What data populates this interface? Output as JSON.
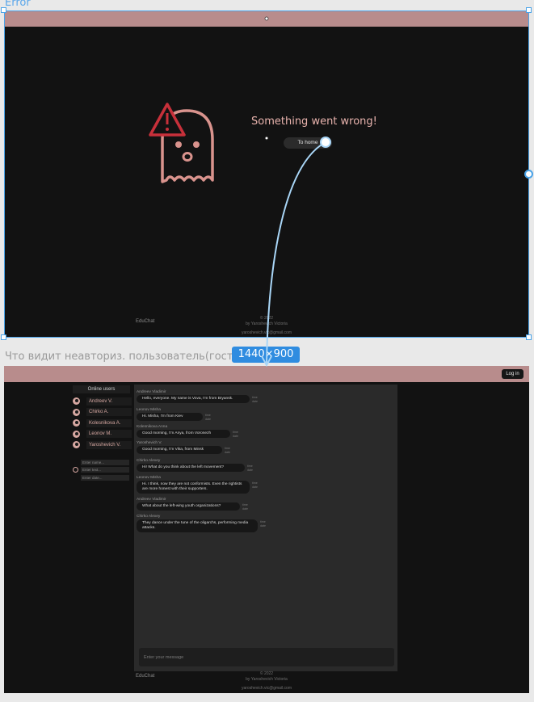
{
  "labels": {
    "error_frame": "Error",
    "chat_frame": "Что видит неавториз. пользователь(гость)",
    "size_badge": "1440×900"
  },
  "error_page": {
    "message": "Something went wrong!",
    "home_button": "To home",
    "footer": {
      "logo": "EduChat",
      "copyright": "© 2022",
      "author": "by Yaroshevich Victoria",
      "email": "yaroshevich.vic@gmail.com"
    }
  },
  "chat_page": {
    "login_button": "Log in",
    "sidebar": {
      "title": "Online users",
      "users": [
        {
          "name": "Andreev V."
        },
        {
          "name": "Chirko A."
        },
        {
          "name": "Kolesnikova A."
        },
        {
          "name": "Leonov M."
        },
        {
          "name": "Yaroshevich V."
        }
      ],
      "filters": {
        "name_placeholder": "Enter name...",
        "text_placeholder": "Enter text...",
        "date_placeholder": "Enter date..."
      }
    },
    "messages": [
      {
        "author": "Andreev Vladimir",
        "text": "Hello, everyone. My name is Vova, I'm from Bryansk.",
        "date": "time",
        "time": "date"
      },
      {
        "author": "Leonov Misha",
        "text": "Hi. Misha, I'm from Kiev",
        "date": "time",
        "time": "date"
      },
      {
        "author": "Kolesnikova Anna",
        "text": "Good morning, I'm Anya, from Voronezh",
        "date": "time",
        "time": "date"
      },
      {
        "author": "Yaroshevich V.",
        "text": "Good morning, I'm Vika, from Minsk",
        "date": "time",
        "time": "date"
      },
      {
        "author": "Chirko Alexey",
        "text": "Hi! What do you think about the left movement?",
        "date": "time",
        "time": "date"
      },
      {
        "author": "Leonov Misha",
        "text": "Hi. I think, now they are not conformists. Even the rightists are more honest with their supporters.",
        "date": "time",
        "time": "date"
      },
      {
        "author": "Andreev Vladimir",
        "text": "What about the left-wing youth organizations?",
        "date": "time",
        "time": "date"
      },
      {
        "author": "Chirko Alexey",
        "text": "They dance under the tune of the oligarchs, performing media attacks.",
        "date": "time",
        "time": "date"
      }
    ],
    "message_placeholder": "Enter your message",
    "footer": {
      "logo": "EduChat",
      "copyright": "© 2022",
      "author": "by Yaroshevich Victoria",
      "email": "yaroshevich.vic@gmail.com"
    }
  },
  "colors": {
    "topbar": "#b88c8c",
    "background": "#121212",
    "accent": "#d7a8a2",
    "selection": "#4aa3e8"
  }
}
